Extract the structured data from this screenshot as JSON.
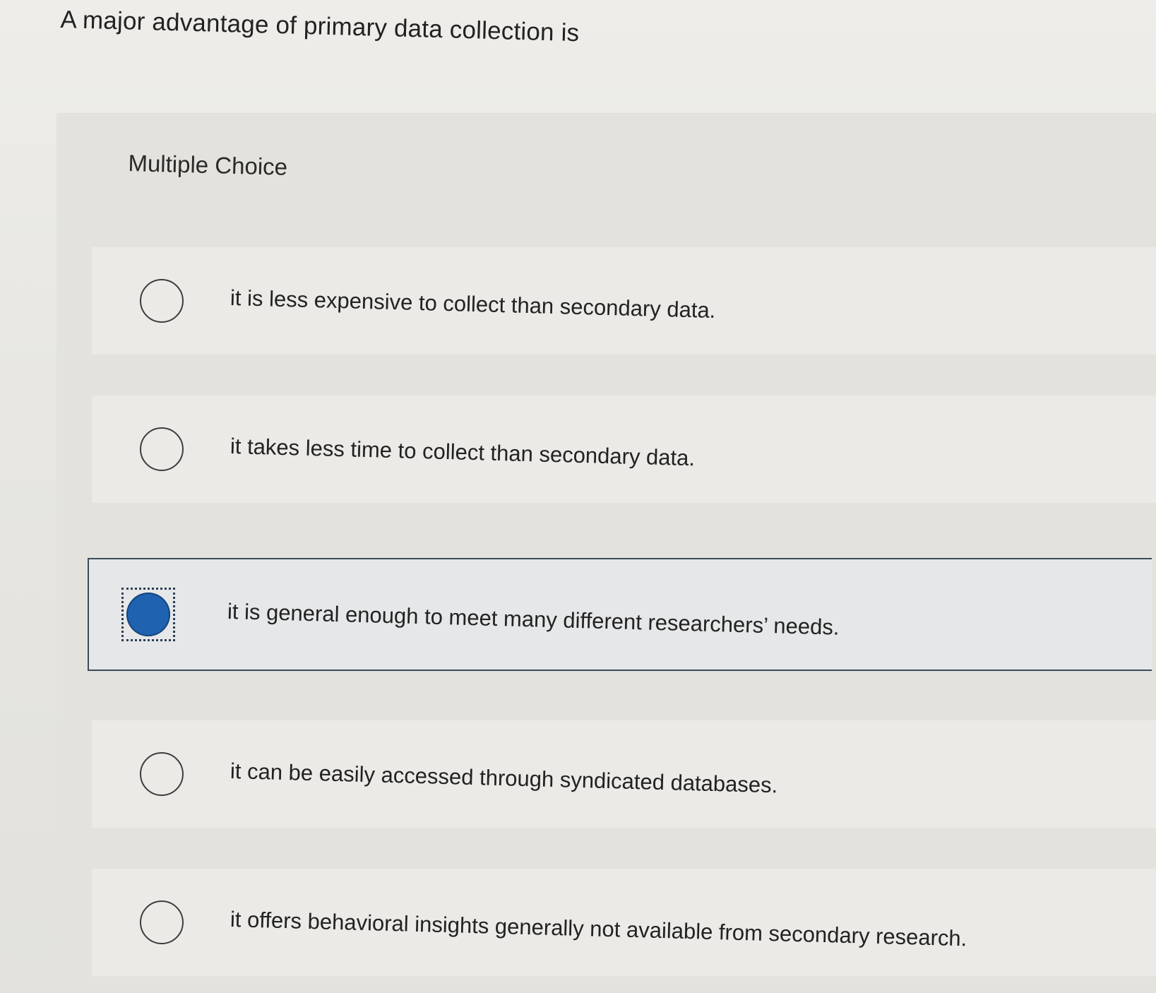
{
  "question": {
    "title": "A major advantage of primary data collection is"
  },
  "question_type": "Multiple Choice",
  "options": [
    {
      "label": "it is less expensive to collect than secondary data.",
      "selected": false
    },
    {
      "label": "it takes less time to collect than secondary data.",
      "selected": false
    },
    {
      "label": "it is general enough to meet many different researchers’ needs.",
      "selected": true
    },
    {
      "label": "it can be easily accessed through syndicated databases.",
      "selected": false
    },
    {
      "label": "it offers behavioral insights generally not available from secondary research.",
      "selected": false
    }
  ],
  "colors": {
    "selected_radio": "#1e62b0",
    "selected_border": "#3c4a5a",
    "background": "#e9e8e4"
  }
}
